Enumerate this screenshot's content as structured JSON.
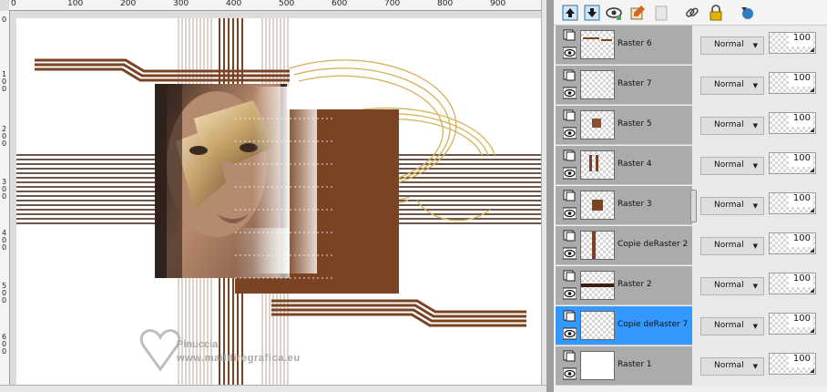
{
  "ruler": {
    "top_labels": [
      "0",
      "100",
      "200",
      "300",
      "400",
      "500",
      "600",
      "700",
      "800",
      "900"
    ],
    "left_labels": [
      "0",
      "1\n0\n0",
      "2\n0\n0",
      "3\n0\n0",
      "4\n0\n0",
      "5\n0\n0",
      "6\n0\n0"
    ]
  },
  "watermark": {
    "line1": "Pinuccia",
    "line2": "www.maildiregrafica.eu"
  },
  "toolbar": {
    "icons": [
      "move-layer-up-icon",
      "move-layer-down-icon",
      "toggle-visibility-icon",
      "edit-mask-icon",
      "delete-layer-icon",
      "link-layers-icon",
      "lock-layer-icon",
      "refresh-icon"
    ]
  },
  "layers": [
    {
      "name": "Raster 6",
      "blend": "Normal",
      "opacity": "100",
      "selected": false,
      "thumb": "raster6"
    },
    {
      "name": "Raster 7",
      "blend": "Normal",
      "opacity": "100",
      "selected": false,
      "thumb": "empty"
    },
    {
      "name": "Raster 5",
      "blend": "Normal",
      "opacity": "100",
      "selected": false,
      "thumb": "raster5"
    },
    {
      "name": "Raster 4",
      "blend": "Normal",
      "opacity": "100",
      "selected": false,
      "thumb": "raster4"
    },
    {
      "name": "Raster 3",
      "blend": "Normal",
      "opacity": "100",
      "selected": false,
      "thumb": "raster3"
    },
    {
      "name": "Copie deRaster 2",
      "blend": "Normal",
      "opacity": "100",
      "selected": false,
      "thumb": "copie2"
    },
    {
      "name": "Raster 2",
      "blend": "Normal",
      "opacity": "100",
      "selected": false,
      "thumb": "raster2"
    },
    {
      "name": "Copie deRaster 7",
      "blend": "Normal",
      "opacity": "100",
      "selected": true,
      "thumb": "empty"
    },
    {
      "name": "Raster 1",
      "blend": "Normal",
      "opacity": "100",
      "selected": false,
      "thumb": "white"
    }
  ],
  "colors": {
    "selected": "#3399ff",
    "brown": "#7a4424",
    "dark_brown": "#3d1f0f",
    "gold": "#d4b25a",
    "layer_bg": "#ababab"
  }
}
